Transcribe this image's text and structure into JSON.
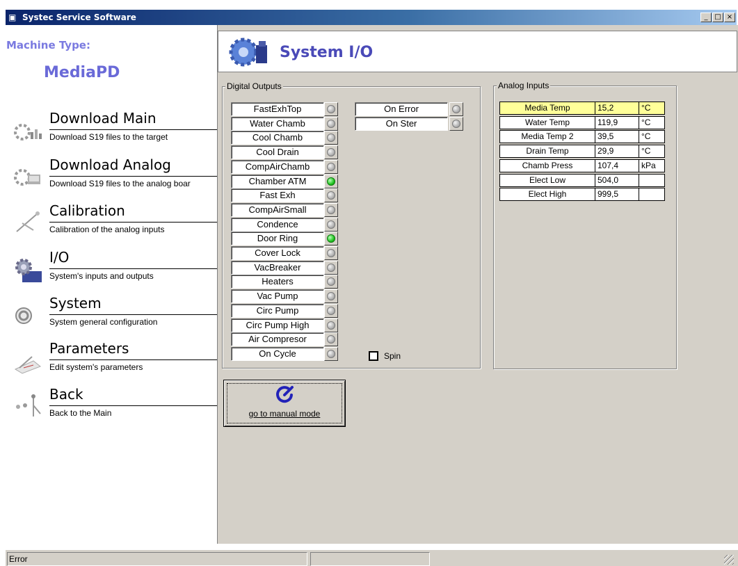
{
  "window": {
    "title": "Systec Service Software",
    "minimize": "_",
    "maximize": "□",
    "close": "×"
  },
  "sidebar": {
    "machine_type_label": "Machine Type:",
    "machine_type_value": "MediaPD",
    "items": [
      {
        "title": "Download Main",
        "desc": "Download S19 files to the target",
        "icon": "download-main-icon"
      },
      {
        "title": "Download Analog",
        "desc": "Download S19 files to the analog boar",
        "icon": "download-analog-icon"
      },
      {
        "title": "Calibration",
        "desc": "Calibration of the analog inputs",
        "icon": "calibration-icon"
      },
      {
        "title": "I/O",
        "desc": "System's inputs and outputs",
        "icon": "gear-icon"
      },
      {
        "title": "System",
        "desc": "System general configuration",
        "icon": "system-icon"
      },
      {
        "title": "Parameters",
        "desc": "Edit system's parameters",
        "icon": "parameters-icon"
      },
      {
        "title": "Back",
        "desc": "Back to the Main",
        "icon": "back-icon"
      }
    ]
  },
  "header": {
    "title": "System I/O"
  },
  "digital_outputs": {
    "legend": "Digital Outputs",
    "column1": [
      {
        "label": "FastExhTop",
        "on": false
      },
      {
        "label": "Water Chamb",
        "on": false
      },
      {
        "label": "Cool Chamb",
        "on": false
      },
      {
        "label": "Cool Drain",
        "on": false
      },
      {
        "label": "CompAirChamb",
        "on": false
      },
      {
        "label": "Chamber ATM",
        "on": true
      },
      {
        "label": "Fast Exh",
        "on": false
      },
      {
        "label": "CompAirSmall",
        "on": false
      },
      {
        "label": "Condence",
        "on": false
      },
      {
        "label": "Door Ring",
        "on": true
      },
      {
        "label": "Cover Lock",
        "on": false
      },
      {
        "label": "VacBreaker",
        "on": false
      },
      {
        "label": "Heaters",
        "on": false
      },
      {
        "label": "Vac Pump",
        "on": false
      },
      {
        "label": "Circ Pump",
        "on": false
      },
      {
        "label": "Circ Pump High",
        "on": false
      },
      {
        "label": "Air Compresor",
        "on": false
      },
      {
        "label": "On Cycle",
        "on": false
      }
    ],
    "column2": [
      {
        "label": "On Error",
        "on": false
      },
      {
        "label": "On Ster",
        "on": false
      }
    ],
    "spin_label": "Spin",
    "spin_checked": false
  },
  "analog_inputs": {
    "legend": "Analog Inputs",
    "rows": [
      {
        "name": "Media Temp",
        "value": "15,2",
        "unit": "°C",
        "highlight": true
      },
      {
        "name": "Water Temp",
        "value": "119,9",
        "unit": "°C",
        "highlight": false
      },
      {
        "name": "Media Temp 2",
        "value": "39,5",
        "unit": "°C",
        "highlight": false
      },
      {
        "name": "Drain Temp",
        "value": "29,9",
        "unit": "°C",
        "highlight": false
      },
      {
        "name": "Chamb Press",
        "value": "107,4",
        "unit": "kPa",
        "highlight": false
      },
      {
        "name": "Elect Low",
        "value": "504,0",
        "unit": "",
        "highlight": false
      },
      {
        "name": "Elect High",
        "value": "999,5",
        "unit": "",
        "highlight": false
      }
    ]
  },
  "manual_button": {
    "label": "go to manual mode"
  },
  "statusbar": {
    "panel1": "Error",
    "panel2": ""
  }
}
